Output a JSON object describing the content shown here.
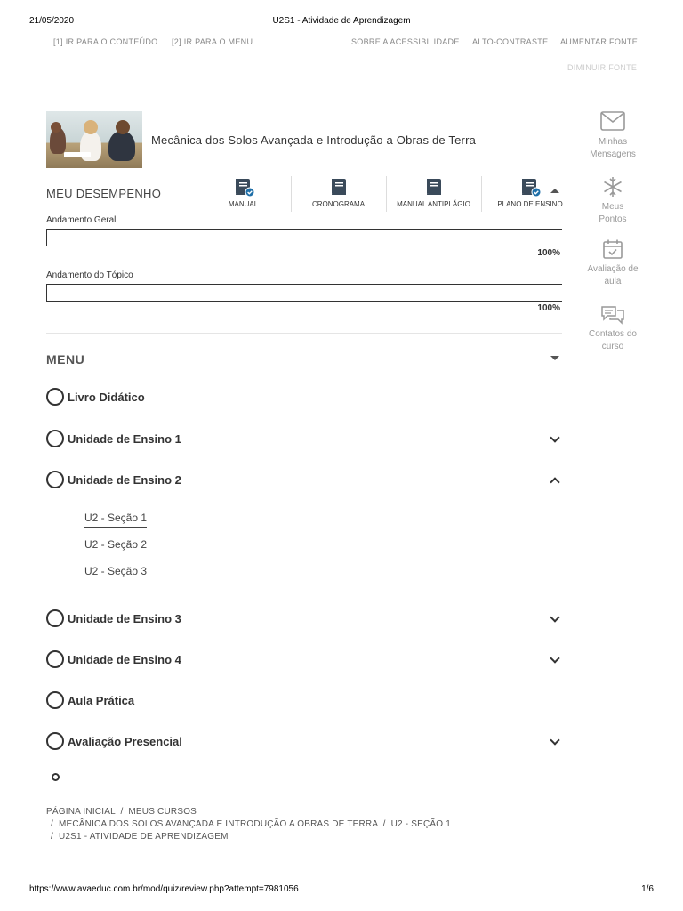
{
  "print_header": {
    "date": "21/05/2020",
    "title": "U2S1 - Atividade de Aprendizagem"
  },
  "print_footer": {
    "url": "https://www.avaeduc.com.br/mod/quiz/review.php?attempt=7981056",
    "page": "1/6"
  },
  "skip_links": {
    "content": "[1] IR PARA O CONTEÚDO",
    "menu": "[2] IR PARA O MENU"
  },
  "accessibility": {
    "about": "SOBRE A ACESSIBILIDADE",
    "contrast": "ALTO-CONTRASTE",
    "increase_font": "AUMENTAR FONTE",
    "decrease_font": "DIMINUIR FONTE"
  },
  "course": {
    "title": "Mecânica dos Solos Avançada e Introdução a Obras de Terra"
  },
  "performance": {
    "title": "MEU DESEMPENHO",
    "docs": [
      {
        "label": "MANUAL",
        "icon": "book-check-icon"
      },
      {
        "label": "CRONOGRAMA",
        "icon": "book-icon"
      },
      {
        "label": "MANUAL ANTIPLÁGIO",
        "icon": "book-icon"
      },
      {
        "label": "PLANO DE ENSINO",
        "icon": "book-check-icon"
      }
    ],
    "general_label": "Andamento Geral",
    "general_value": 1.0,
    "general_pct": "100%",
    "topic_label": "Andamento do Tópico",
    "topic_value": 1.0,
    "topic_pct": "100%"
  },
  "menu": {
    "title": "MENU",
    "items": [
      {
        "label": "Livro Didático"
      },
      {
        "label": "Unidade de Ensino 1"
      },
      {
        "label": "Unidade de Ensino 2"
      },
      {
        "label": "Unidade de Ensino 3"
      },
      {
        "label": "Unidade de Ensino 4"
      },
      {
        "label": "Aula Prática"
      },
      {
        "label": "Avaliação Presencial"
      }
    ],
    "sub_items": [
      "U2 - Seção 1",
      "U2 - Seção 2",
      "U2 - Seção 3"
    ]
  },
  "breadcrumb": {
    "home": "PÁGINA INICIAL",
    "sep": "/",
    "courses": "MEUS CURSOS",
    "course": "MECÂNICA DOS SOLOS AVANÇADA E INTRODUÇÃO A OBRAS DE TERRA",
    "section": "U2 - SEÇÃO 1",
    "activity": "U2S1 - ATIVIDADE DE APRENDIZAGEM"
  },
  "sidebar": {
    "messages": [
      "Minhas",
      "Mensagens"
    ],
    "points": [
      "Meus",
      "Pontos"
    ],
    "evaluation": [
      "Avaliação de",
      "aula"
    ],
    "contacts": [
      "Contatos do",
      "curso"
    ]
  },
  "colors": {
    "badge": "#1f6fa8",
    "icon_dark": "#3a4a5a",
    "text": "#333333",
    "muted": "#999999"
  }
}
